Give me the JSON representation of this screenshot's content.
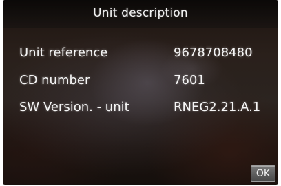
{
  "screen": {
    "title": "Unit description",
    "rows": [
      {
        "label": "Unit reference",
        "value": "9678708480"
      },
      {
        "label": "CD number",
        "value": "7601"
      },
      {
        "label": "SW Version. - unit",
        "value": "RNEG2.21.A.1"
      }
    ],
    "ok_label": "OK"
  }
}
